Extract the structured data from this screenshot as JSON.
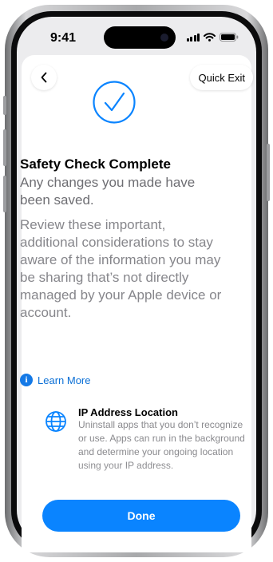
{
  "status_bar": {
    "time": "9:41"
  },
  "nav": {
    "back_icon": "chevron-left-icon",
    "quick_exit": "Quick Exit"
  },
  "header": {
    "icon": "checkmark-circle-icon",
    "title": "Safety Check Complete",
    "subtitle": "Any changes you made have been saved."
  },
  "body": {
    "text": "Review these important, additional considerations to stay aware of the information you may be sharing that’s not directly managed by your Apple device or account.",
    "learn_more": "Learn More"
  },
  "items": [
    {
      "icon": "globe-icon",
      "title": "IP Address Location",
      "description": "Uninstall apps that you don’t recognize or use. Apps can run in the background and determine your ongoing location using your IP address."
    }
  ],
  "footer": {
    "done_label": "Done"
  },
  "colors": {
    "accent": "#0a84ff",
    "link": "#0a6fd6",
    "secondary_text": "#86868b"
  }
}
